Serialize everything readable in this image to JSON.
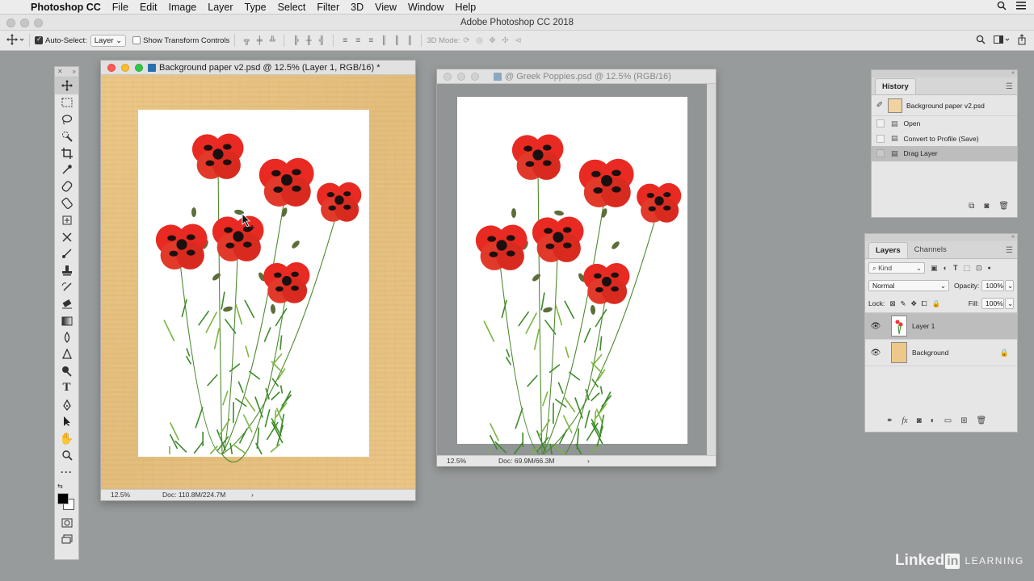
{
  "menubar": {
    "app": "Photoshop CC",
    "items": [
      "File",
      "Edit",
      "Image",
      "Layer",
      "Type",
      "Select",
      "Filter",
      "3D",
      "View",
      "Window",
      "Help"
    ]
  },
  "window_title": "Adobe Photoshop CC 2018",
  "options": {
    "auto_select_label": "Auto-Select:",
    "auto_select_value": "Layer",
    "transform_label": "Show Transform Controls",
    "mode3d_label": "3D Mode:"
  },
  "doc1": {
    "title": "Background paper v2.psd @ 12.5% (Layer 1, RGB/16) *",
    "zoom": "12.5%",
    "doc_size": "Doc: 110.8M/224.7M"
  },
  "doc2": {
    "title": "@ Greek Poppies.psd @ 12.5% (RGB/16)",
    "zoom": "12.5%",
    "doc_size": "Doc: 69.9M/66.3M"
  },
  "history": {
    "tab": "History",
    "snapshot": "Background paper v2.psd",
    "items": [
      "Open",
      "Convert to Profile (Save)",
      "Drag Layer"
    ]
  },
  "layers": {
    "tab_layers": "Layers",
    "tab_channels": "Channels",
    "kind": "Kind",
    "blend_mode": "Normal",
    "opacity_label": "Opacity:",
    "opacity_value": "100%",
    "lock_label": "Lock:",
    "fill_label": "Fill:",
    "fill_value": "100%",
    "items": [
      "Layer 1",
      "Background"
    ]
  },
  "watermark": {
    "brand": "Linked",
    "brand_box": "in",
    "suffix": "LEARNING"
  },
  "colors": {
    "accent_selected": "#bdbdbd",
    "paper": "#e6c383",
    "poppy": "#e82a22"
  }
}
